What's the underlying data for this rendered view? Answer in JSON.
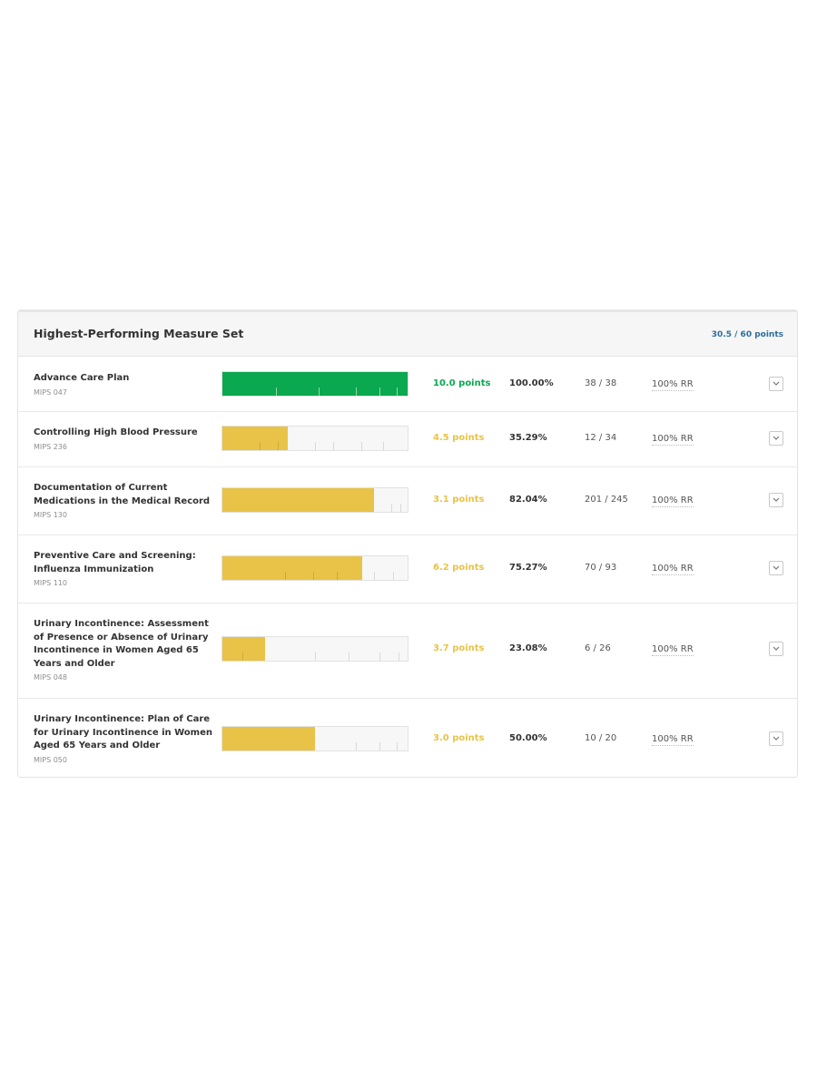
{
  "panel": {
    "title": "Highest-Performing Measure Set",
    "total": "30.5 / 60 points"
  },
  "colors": {
    "green": "#0aa84f",
    "yellow": "#e8c347",
    "total_blue": "#2c6e9c"
  },
  "measures": [
    {
      "name": "Advance Care Plan",
      "code": "MIPS 047",
      "points": "10.0 points",
      "percent": "100.00%",
      "ratio": "38 / 38",
      "rr": "100% RR",
      "status": "green",
      "fill_fraction": 1.0,
      "benchmark_ticks": [
        0.29,
        0.52,
        0.72,
        0.85,
        0.94
      ]
    },
    {
      "name": "Controlling High Blood Pressure",
      "code": "MIPS 236",
      "points": "4.5 points",
      "percent": "35.29%",
      "ratio": "12 / 34",
      "rr": "100% RR",
      "status": "yellow",
      "fill_fraction": 0.3529,
      "benchmark_ticks": [
        0.2,
        0.3,
        0.5,
        0.6,
        0.75,
        0.87
      ]
    },
    {
      "name": "Documentation of Current Medications in the Medical Record",
      "code": "MIPS 130",
      "points": "3.1 points",
      "percent": "82.04%",
      "ratio": "201 / 245",
      "rr": "100% RR",
      "status": "yellow",
      "fill_fraction": 0.8204,
      "benchmark_ticks": [
        0.91,
        0.96
      ]
    },
    {
      "name": "Preventive Care and Screening: Influenza Immunization",
      "code": "MIPS 110",
      "points": "6.2 points",
      "percent": "75.27%",
      "ratio": "70 / 93",
      "rr": "100% RR",
      "status": "yellow",
      "fill_fraction": 0.7527,
      "benchmark_ticks": [
        0.34,
        0.49,
        0.62,
        0.82,
        0.92
      ]
    },
    {
      "name": "Urinary Incontinence: Assessment of Presence or Absence of Urinary Incontinence in Women Aged 65 Years and Older",
      "code": "MIPS 048",
      "points": "3.7 points",
      "percent": "23.08%",
      "ratio": "6 / 26",
      "rr": "100% RR",
      "status": "yellow",
      "fill_fraction": 0.2308,
      "benchmark_ticks": [
        0.11,
        0.5,
        0.68,
        0.85,
        0.95
      ]
    },
    {
      "name": "Urinary Incontinence: Plan of Care for Urinary Incontinence in Women Aged 65 Years and Older",
      "code": "MIPS 050",
      "points": "3.0 points",
      "percent": "50.00%",
      "ratio": "10 / 20",
      "rr": "100% RR",
      "status": "yellow",
      "fill_fraction": 0.5,
      "benchmark_ticks": [
        0.72,
        0.85,
        0.94
      ]
    }
  ]
}
